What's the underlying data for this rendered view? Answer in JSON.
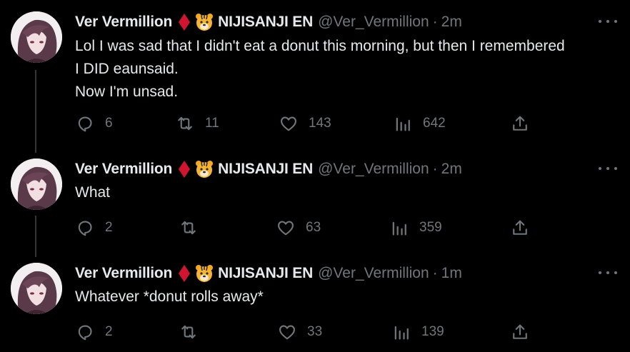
{
  "colors": {
    "background": "#000000",
    "text_primary": "#e7e9ea",
    "text_secondary": "#71767b",
    "thread_line": "#333639",
    "diamond_red": "#d1142f"
  },
  "tweets": [
    {
      "display_name": "Ver Vermillion",
      "badge_icons": [
        "red-diamond-icon",
        "tiger-face-icon"
      ],
      "affiliation": "NIJISANJI EN",
      "handle": "@Ver_Vermillion",
      "separator": "·",
      "time": "2m",
      "text_lines": [
        "Lol I was sad that I didn't eat a donut this morning, but then I remembered",
        "I DID eaunsaid.",
        "Now I'm unsad."
      ],
      "replies": "6",
      "retweets": "11",
      "likes": "143",
      "views": "642"
    },
    {
      "display_name": "Ver Vermillion",
      "badge_icons": [
        "red-diamond-icon",
        "tiger-face-icon"
      ],
      "affiliation": "NIJISANJI EN",
      "handle": "@Ver_Vermillion",
      "separator": "·",
      "time": "2m",
      "text_lines": [
        "What"
      ],
      "replies": "2",
      "retweets": "",
      "likes": "63",
      "views": "359"
    },
    {
      "display_name": "Ver Vermillion",
      "badge_icons": [
        "red-diamond-icon",
        "tiger-face-icon"
      ],
      "affiliation": "NIJISANJI EN",
      "handle": "@Ver_Vermillion",
      "separator": "·",
      "time": "1m",
      "text_lines": [
        "Whatever *donut rolls away*"
      ],
      "replies": "2",
      "retweets": "",
      "likes": "33",
      "views": "139"
    }
  ]
}
